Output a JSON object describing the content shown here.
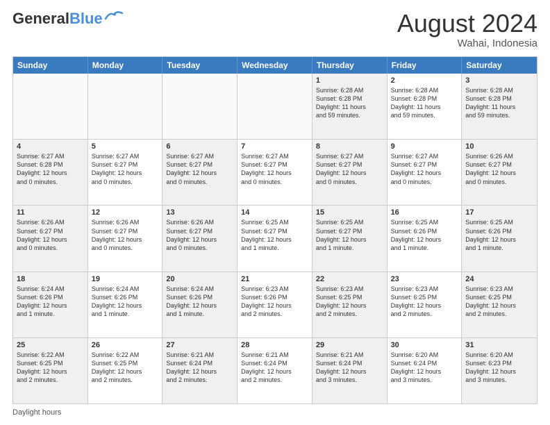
{
  "header": {
    "logo_line1": "General",
    "logo_line2": "Blue",
    "month_year": "August 2024",
    "location": "Wahai, Indonesia"
  },
  "days_of_week": [
    "Sunday",
    "Monday",
    "Tuesday",
    "Wednesday",
    "Thursday",
    "Friday",
    "Saturday"
  ],
  "footer_label": "Daylight hours",
  "weeks": [
    [
      {
        "day": "",
        "lines": []
      },
      {
        "day": "",
        "lines": []
      },
      {
        "day": "",
        "lines": []
      },
      {
        "day": "",
        "lines": []
      },
      {
        "day": "1",
        "lines": [
          "Sunrise: 6:28 AM",
          "Sunset: 6:28 PM",
          "Daylight: 11 hours",
          "and 59 minutes."
        ]
      },
      {
        "day": "2",
        "lines": [
          "Sunrise: 6:28 AM",
          "Sunset: 6:28 PM",
          "Daylight: 11 hours",
          "and 59 minutes."
        ]
      },
      {
        "day": "3",
        "lines": [
          "Sunrise: 6:28 AM",
          "Sunset: 6:28 PM",
          "Daylight: 11 hours",
          "and 59 minutes."
        ]
      }
    ],
    [
      {
        "day": "4",
        "lines": [
          "Sunrise: 6:27 AM",
          "Sunset: 6:28 PM",
          "Daylight: 12 hours",
          "and 0 minutes."
        ]
      },
      {
        "day": "5",
        "lines": [
          "Sunrise: 6:27 AM",
          "Sunset: 6:27 PM",
          "Daylight: 12 hours",
          "and 0 minutes."
        ]
      },
      {
        "day": "6",
        "lines": [
          "Sunrise: 6:27 AM",
          "Sunset: 6:27 PM",
          "Daylight: 12 hours",
          "and 0 minutes."
        ]
      },
      {
        "day": "7",
        "lines": [
          "Sunrise: 6:27 AM",
          "Sunset: 6:27 PM",
          "Daylight: 12 hours",
          "and 0 minutes."
        ]
      },
      {
        "day": "8",
        "lines": [
          "Sunrise: 6:27 AM",
          "Sunset: 6:27 PM",
          "Daylight: 12 hours",
          "and 0 minutes."
        ]
      },
      {
        "day": "9",
        "lines": [
          "Sunrise: 6:27 AM",
          "Sunset: 6:27 PM",
          "Daylight: 12 hours",
          "and 0 minutes."
        ]
      },
      {
        "day": "10",
        "lines": [
          "Sunrise: 6:26 AM",
          "Sunset: 6:27 PM",
          "Daylight: 12 hours",
          "and 0 minutes."
        ]
      }
    ],
    [
      {
        "day": "11",
        "lines": [
          "Sunrise: 6:26 AM",
          "Sunset: 6:27 PM",
          "Daylight: 12 hours",
          "and 0 minutes."
        ]
      },
      {
        "day": "12",
        "lines": [
          "Sunrise: 6:26 AM",
          "Sunset: 6:27 PM",
          "Daylight: 12 hours",
          "and 0 minutes."
        ]
      },
      {
        "day": "13",
        "lines": [
          "Sunrise: 6:26 AM",
          "Sunset: 6:27 PM",
          "Daylight: 12 hours",
          "and 0 minutes."
        ]
      },
      {
        "day": "14",
        "lines": [
          "Sunrise: 6:25 AM",
          "Sunset: 6:27 PM",
          "Daylight: 12 hours",
          "and 1 minute."
        ]
      },
      {
        "day": "15",
        "lines": [
          "Sunrise: 6:25 AM",
          "Sunset: 6:27 PM",
          "Daylight: 12 hours",
          "and 1 minute."
        ]
      },
      {
        "day": "16",
        "lines": [
          "Sunrise: 6:25 AM",
          "Sunset: 6:26 PM",
          "Daylight: 12 hours",
          "and 1 minute."
        ]
      },
      {
        "day": "17",
        "lines": [
          "Sunrise: 6:25 AM",
          "Sunset: 6:26 PM",
          "Daylight: 12 hours",
          "and 1 minute."
        ]
      }
    ],
    [
      {
        "day": "18",
        "lines": [
          "Sunrise: 6:24 AM",
          "Sunset: 6:26 PM",
          "Daylight: 12 hours",
          "and 1 minute."
        ]
      },
      {
        "day": "19",
        "lines": [
          "Sunrise: 6:24 AM",
          "Sunset: 6:26 PM",
          "Daylight: 12 hours",
          "and 1 minute."
        ]
      },
      {
        "day": "20",
        "lines": [
          "Sunrise: 6:24 AM",
          "Sunset: 6:26 PM",
          "Daylight: 12 hours",
          "and 1 minute."
        ]
      },
      {
        "day": "21",
        "lines": [
          "Sunrise: 6:23 AM",
          "Sunset: 6:26 PM",
          "Daylight: 12 hours",
          "and 2 minutes."
        ]
      },
      {
        "day": "22",
        "lines": [
          "Sunrise: 6:23 AM",
          "Sunset: 6:25 PM",
          "Daylight: 12 hours",
          "and 2 minutes."
        ]
      },
      {
        "day": "23",
        "lines": [
          "Sunrise: 6:23 AM",
          "Sunset: 6:25 PM",
          "Daylight: 12 hours",
          "and 2 minutes."
        ]
      },
      {
        "day": "24",
        "lines": [
          "Sunrise: 6:23 AM",
          "Sunset: 6:25 PM",
          "Daylight: 12 hours",
          "and 2 minutes."
        ]
      }
    ],
    [
      {
        "day": "25",
        "lines": [
          "Sunrise: 6:22 AM",
          "Sunset: 6:25 PM",
          "Daylight: 12 hours",
          "and 2 minutes."
        ]
      },
      {
        "day": "26",
        "lines": [
          "Sunrise: 6:22 AM",
          "Sunset: 6:25 PM",
          "Daylight: 12 hours",
          "and 2 minutes."
        ]
      },
      {
        "day": "27",
        "lines": [
          "Sunrise: 6:21 AM",
          "Sunset: 6:24 PM",
          "Daylight: 12 hours",
          "and 2 minutes."
        ]
      },
      {
        "day": "28",
        "lines": [
          "Sunrise: 6:21 AM",
          "Sunset: 6:24 PM",
          "Daylight: 12 hours",
          "and 2 minutes."
        ]
      },
      {
        "day": "29",
        "lines": [
          "Sunrise: 6:21 AM",
          "Sunset: 6:24 PM",
          "Daylight: 12 hours",
          "and 3 minutes."
        ]
      },
      {
        "day": "30",
        "lines": [
          "Sunrise: 6:20 AM",
          "Sunset: 6:24 PM",
          "Daylight: 12 hours",
          "and 3 minutes."
        ]
      },
      {
        "day": "31",
        "lines": [
          "Sunrise: 6:20 AM",
          "Sunset: 6:23 PM",
          "Daylight: 12 hours",
          "and 3 minutes."
        ]
      }
    ]
  ]
}
